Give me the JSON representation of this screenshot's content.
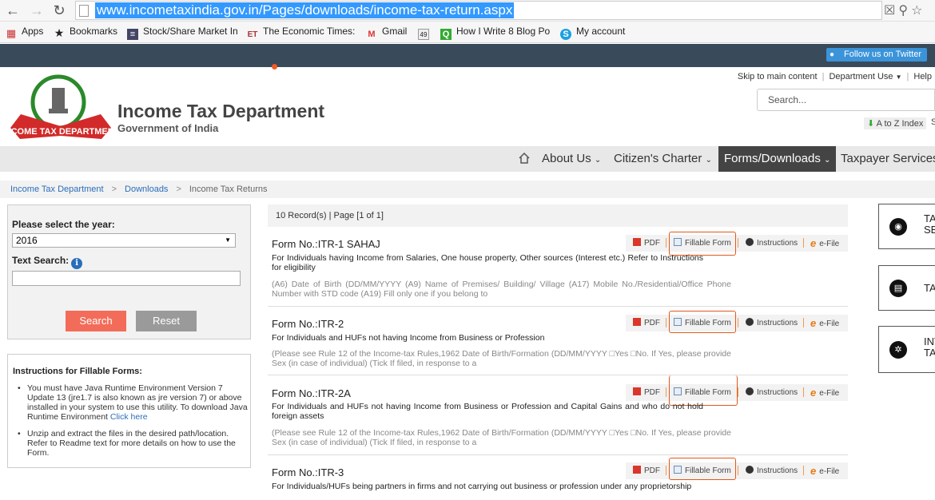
{
  "browser": {
    "url": "www.incometaxindia.gov.in/Pages/downloads/income-tax-return.aspx",
    "bookmarks": [
      {
        "label": "Apps",
        "icon": "apps-icon"
      },
      {
        "label": "Bookmarks",
        "icon": "star-icon"
      },
      {
        "label": "Stock/Share Market In",
        "icon": "stock-icon"
      },
      {
        "label": "The Economic Times:",
        "icon": "et-icon"
      },
      {
        "label": "Gmail",
        "icon": "gmail-icon"
      },
      {
        "label": "",
        "icon": "badge-icon"
      },
      {
        "label": "How I Write 8 Blog Po",
        "icon": "quora-icon"
      },
      {
        "label": "My account",
        "icon": "skype-icon"
      }
    ]
  },
  "site": {
    "twitter": "Follow us on Twitter",
    "title": "Income Tax Department",
    "subtitle": "Government of India",
    "emblem_text": "INCOME TAX DEPARTMENT",
    "util_links": [
      "Skip to main content",
      "Department Use",
      "Help"
    ],
    "search_placeholder": "Search...",
    "atoz": "A to Z Index",
    "atoz_extra": "S",
    "nav": [
      "About Us",
      "Citizen's Charter",
      "Forms/Downloads",
      "Taxpayer Services"
    ]
  },
  "breadcrumb": [
    "Income Tax Department",
    "Downloads",
    "Income Tax Returns"
  ],
  "filter": {
    "year_label": "Please select the year:",
    "year_value": "2016",
    "text_search_label": "Text Search:",
    "search_btn": "Search",
    "reset_btn": "Reset"
  },
  "instructions": {
    "title": "Instructions for Fillable Forms:",
    "item1": "You must have Java Runtime Environment Version 7 Update 13 (jre1.7 is also known as jre version 7) or above installed in your system to use this utility. To download Java Runtime Environment",
    "item1_link": "Click here",
    "item2": "Unzip and extract the files in the desired path/location. Refer to Readme text for more details on how to use the Form."
  },
  "records": {
    "summary": "10 Record(s) | Page [1 of 1]",
    "action_labels": {
      "pdf": "PDF",
      "fillable": "Fillable Form",
      "instructions": "Instructions",
      "efile": "e-File"
    },
    "items": [
      {
        "form_no": "Form No.:ITR-1 SAHAJ",
        "desc": "For Individuals having Income from Salaries, One house property, Other sources (Interest etc.) Refer to Instructions for eligibility",
        "extra": "(A6) Date of Birth (DD/MM/YYYY (A9) Name of Premises/ Building/ Village (A17) Mobile No./Residential/Office Phone Number with STD code (A19) Fill only one if you belong to"
      },
      {
        "form_no": "Form No.:ITR-2",
        "desc": "For Individuals and HUFs not having Income from Business or Profession",
        "extra": "(Please see Rule 12 of the Income-tax Rules,1962 Date of Birth/Formation (DD/MM/YYYY □Yes □No. If Yes, please provide Sex (in case of individual) (Tick If filed, in response to a"
      },
      {
        "form_no": "Form No.:ITR-2A",
        "desc": "For Individuals and HUFs not having Income from Business or Profession and Capital Gains and who do not hold foreign assets",
        "extra": "(Please see Rule 12 of the Income-tax Rules,1962 Date of Birth/Formation (DD/MM/YYYY □Yes □No. If Yes, please provide Sex (in case of individual) (Tick If filed, in response to a"
      },
      {
        "form_no": "Form No.:ITR-3",
        "desc": "For Individuals/HUFs being partners in firms and not carrying out business or profession under any proprietorship",
        "extra": ""
      }
    ]
  },
  "side_panels": [
    "TA SE",
    "TA",
    "INT TA"
  ]
}
